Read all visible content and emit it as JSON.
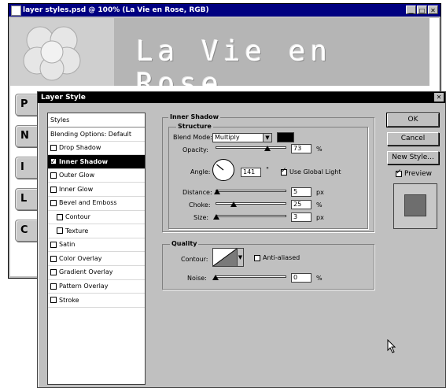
{
  "document_window": {
    "title": "layer styles.psd @ 100% (La Vie en Rose, RGB)",
    "controls": {
      "minimize": "▁",
      "maximize": "□",
      "close": "✕"
    },
    "banner_title": "La Vie en Rose",
    "nav_buttons": [
      "P",
      "N",
      "I",
      "L",
      "C"
    ]
  },
  "dialog": {
    "title": "Layer Style",
    "close_glyph": "✕",
    "styles_list": {
      "header": "Styles",
      "items": [
        {
          "label": "Blending Options: Default",
          "checkbox": false,
          "checked": false,
          "indent": false,
          "selected": false
        },
        {
          "label": "Drop Shadow",
          "checkbox": true,
          "checked": false,
          "indent": false,
          "selected": false
        },
        {
          "label": "Inner Shadow",
          "checkbox": true,
          "checked": true,
          "indent": false,
          "selected": true
        },
        {
          "label": "Outer Glow",
          "checkbox": true,
          "checked": false,
          "indent": false,
          "selected": false
        },
        {
          "label": "Inner Glow",
          "checkbox": true,
          "checked": false,
          "indent": false,
          "selected": false
        },
        {
          "label": "Bevel and Emboss",
          "checkbox": true,
          "checked": false,
          "indent": false,
          "selected": false
        },
        {
          "label": "Contour",
          "checkbox": true,
          "checked": false,
          "indent": true,
          "selected": false
        },
        {
          "label": "Texture",
          "checkbox": true,
          "checked": false,
          "indent": true,
          "selected": false
        },
        {
          "label": "Satin",
          "checkbox": true,
          "checked": false,
          "indent": false,
          "selected": false
        },
        {
          "label": "Color Overlay",
          "checkbox": true,
          "checked": false,
          "indent": false,
          "selected": false
        },
        {
          "label": "Gradient Overlay",
          "checkbox": true,
          "checked": false,
          "indent": false,
          "selected": false
        },
        {
          "label": "Pattern Overlay",
          "checkbox": true,
          "checked": false,
          "indent": false,
          "selected": false
        },
        {
          "label": "Stroke",
          "checkbox": true,
          "checked": false,
          "indent": false,
          "selected": false
        }
      ]
    },
    "inner_shadow": {
      "section_title": "Inner Shadow",
      "structure_title": "Structure",
      "blend_mode_label": "Blend Mode:",
      "blend_mode_value": "Multiply",
      "shadow_color": "#000000",
      "opacity_label": "Opacity:",
      "opacity_value": "73",
      "opacity_unit": "%",
      "opacity_fraction": 0.73,
      "angle_label": "Angle:",
      "angle_value": "141",
      "angle_unit": "°",
      "use_global_light_label": "Use Global Light",
      "use_global_light_checked": true,
      "distance_label": "Distance:",
      "distance_value": "5",
      "distance_unit": "px",
      "distance_fraction": 0.02,
      "choke_label": "Choke:",
      "choke_value": "25",
      "choke_unit": "%",
      "choke_fraction": 0.25,
      "size_label": "Size:",
      "size_value": "3",
      "size_unit": "px",
      "size_fraction": 0.01
    },
    "quality": {
      "title": "Quality",
      "contour_label": "Contour:",
      "anti_aliased_label": "Anti-aliased",
      "anti_aliased_checked": false,
      "noise_label": "Noise:",
      "noise_value": "0",
      "noise_unit": "%",
      "noise_fraction": 0.0
    },
    "buttons": {
      "ok": "OK",
      "cancel": "Cancel",
      "new_style": "New Style...",
      "preview_label": "Preview",
      "preview_checked": true
    }
  }
}
